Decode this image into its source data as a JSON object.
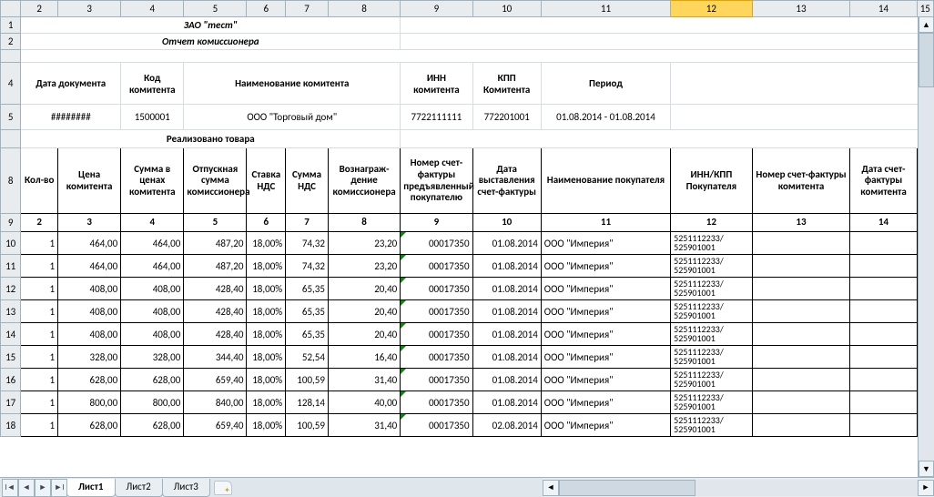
{
  "company": "ЗАО \"тест\"",
  "report_title": "Отчет комиссионера",
  "head_labels": {
    "doc_date": "Дата документа",
    "kom_code": "Код комитента",
    "kom_name": "Наименование комитента",
    "inn": "ИНН комитента",
    "kpp": "КПП Комитента",
    "period": "Период"
  },
  "head_values": {
    "doc_date": "########",
    "kom_code": "1500001",
    "kom_name": "ООО \"Торговый дом\"",
    "inn": "7722111111",
    "kpp": "772201001",
    "period": "01.08.2014 - 01.08.2014"
  },
  "section_title": "Реализовано товара",
  "cols": {
    "c2": "Кол-во",
    "c3": "Цена комитента",
    "c4": "Сумма в ценах комитента",
    "c5": "Отпускная сумма комиссионера",
    "c6": "Ставка НДС",
    "c7": "Сумма НДС",
    "c8": "Вознаграж-дение комиссионера",
    "c9": "Номер счет-фактуры предъявленный покупателю",
    "c10": "Дата выставления счет-фактуры",
    "c11": "Наименование покупателя",
    "c12": "ИНН/КПП Покупателя",
    "c13": "Номер счет-фактуры комитента",
    "c14": "Дата  счет-фактуры комитента"
  },
  "col_nums": {
    "c2": "2",
    "c3": "3",
    "c4": "4",
    "c5": "5",
    "c6": "6",
    "c7": "7",
    "c8": "8",
    "c9": "9",
    "c10": "10",
    "c11": "11",
    "c12": "12",
    "c13": "13",
    "c14": "14"
  },
  "chart_data": {
    "type": "table",
    "columns": [
      "Кол-во",
      "Цена комитента",
      "Сумма в ценах комитента",
      "Отпускная сумма комиссионера",
      "Ставка НДС",
      "Сумма НДС",
      "Вознаграж-дение комиссионера",
      "Номер счет-фактуры",
      "Дата выставления",
      "Наименование покупателя",
      "ИНН/КПП Покупателя"
    ],
    "rows": [
      {
        "qty": "1",
        "price": "464,00",
        "sum": "464,00",
        "rel": "487,20",
        "rate": "18,00%",
        "vat": "74,32",
        "fee": "23,20",
        "inv": "00017350",
        "date": "01.08.2014",
        "buyer": "ООО \"Империя\"",
        "innkpp": "5251112233/ 525901001"
      },
      {
        "qty": "1",
        "price": "464,00",
        "sum": "464,00",
        "rel": "487,20",
        "rate": "18,00%",
        "vat": "74,32",
        "fee": "23,20",
        "inv": "00017350",
        "date": "01.08.2014",
        "buyer": "ООО \"Империя\"",
        "innkpp": "5251112233/ 525901001"
      },
      {
        "qty": "1",
        "price": "408,00",
        "sum": "408,00",
        "rel": "428,40",
        "rate": "18,00%",
        "vat": "65,35",
        "fee": "20,40",
        "inv": "00017350",
        "date": "01.08.2014",
        "buyer": "ООО \"Империя\"",
        "innkpp": "5251112233/ 525901001"
      },
      {
        "qty": "1",
        "price": "408,00",
        "sum": "408,00",
        "rel": "428,40",
        "rate": "18,00%",
        "vat": "65,35",
        "fee": "20,40",
        "inv": "00017350",
        "date": "01.08.2014",
        "buyer": "ООО \"Империя\"",
        "innkpp": "5251112233/ 525901001"
      },
      {
        "qty": "1",
        "price": "408,00",
        "sum": "408,00",
        "rel": "428,40",
        "rate": "18,00%",
        "vat": "65,35",
        "fee": "20,40",
        "inv": "00017350",
        "date": "01.08.2014",
        "buyer": "ООО \"Империя\"",
        "innkpp": "5251112233/ 525901001"
      },
      {
        "qty": "1",
        "price": "328,00",
        "sum": "328,00",
        "rel": "344,40",
        "rate": "18,00%",
        "vat": "52,54",
        "fee": "16,40",
        "inv": "00017350",
        "date": "01.08.2014",
        "buyer": "ООО \"Империя\"",
        "innkpp": "5251112233/ 525901001"
      },
      {
        "qty": "1",
        "price": "628,00",
        "sum": "628,00",
        "rel": "659,40",
        "rate": "18,00%",
        "vat": "100,59",
        "fee": "31,40",
        "inv": "00017350",
        "date": "01.08.2014",
        "buyer": "ООО \"Империя\"",
        "innkpp": "5251112233/ 525901001"
      },
      {
        "qty": "1",
        "price": "800,00",
        "sum": "800,00",
        "rel": "840,00",
        "rate": "18,00%",
        "vat": "128,14",
        "fee": "40,00",
        "inv": "00017350",
        "date": "01.08.2014",
        "buyer": "ООО \"Империя\"",
        "innkpp": "5251112233/ 525901001"
      },
      {
        "qty": "1",
        "price": "628,00",
        "sum": "628,00",
        "rel": "659,40",
        "rate": "18,00%",
        "vat": "100,59",
        "fee": "31,40",
        "inv": "00017350",
        "date": "02.08.2014",
        "buyer": "ООО \"Империя\"",
        "innkpp": "5251112233/ 525901001"
      }
    ]
  },
  "tabs": [
    "Лист1",
    "Лист2",
    "Лист3"
  ],
  "col_letters": [
    "2",
    "3",
    "4",
    "5",
    "6",
    "7",
    "8",
    "9",
    "10",
    "11",
    "12",
    "13",
    "14",
    "15"
  ],
  "row_numbers": [
    "1",
    "2",
    "",
    "4",
    "5",
    "",
    "8",
    "9",
    "10",
    "11",
    "12",
    "13",
    "14",
    "15",
    "16",
    "17",
    "18"
  ],
  "active_col": "12"
}
